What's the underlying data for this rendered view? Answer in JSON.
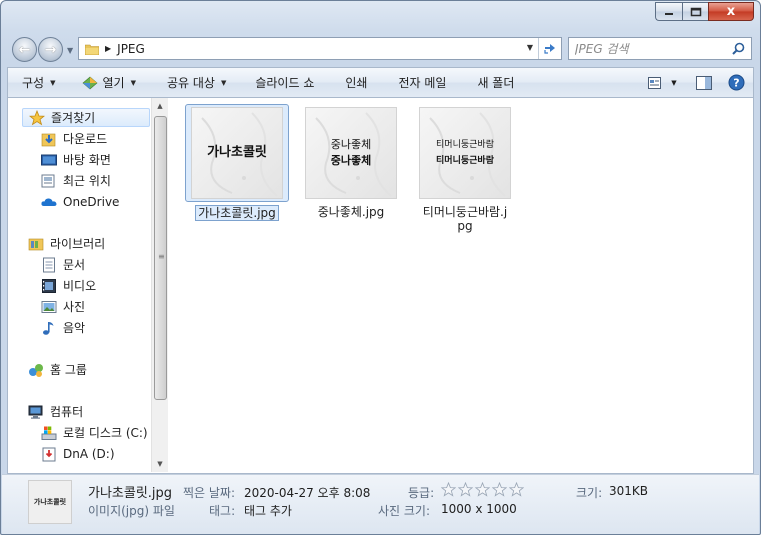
{
  "window": {
    "caption": {
      "close": "x"
    }
  },
  "nav": {
    "breadcrumb": "JPEG",
    "search_placeholder": "JPEG 검색"
  },
  "toolbar": {
    "items": [
      {
        "label": "구성",
        "has_arrow": true
      },
      {
        "label": "열기",
        "has_arrow": true,
        "icon": "open-with-icon"
      },
      {
        "label": "공유 대상",
        "has_arrow": true
      },
      {
        "label": "슬라이드 쇼",
        "has_arrow": false
      },
      {
        "label": "인쇄",
        "has_arrow": false
      },
      {
        "label": "전자 메일",
        "has_arrow": false
      },
      {
        "label": "새 폴더",
        "has_arrow": false
      }
    ]
  },
  "sidebar": {
    "favorites": {
      "label": "즐겨찾기",
      "icon": "star-icon"
    },
    "favorites_items": [
      {
        "label": "다운로드",
        "icon": "downloads-folder-icon"
      },
      {
        "label": "바탕 화면",
        "icon": "desktop-icon"
      },
      {
        "label": "최근 위치",
        "icon": "recent-places-icon"
      },
      {
        "label": "OneDrive",
        "icon": "cloud-icon"
      }
    ],
    "libraries": {
      "label": "라이브러리",
      "icon": "library-icon"
    },
    "libraries_items": [
      {
        "label": "문서",
        "icon": "documents-icon"
      },
      {
        "label": "비디오",
        "icon": "video-icon"
      },
      {
        "label": "사진",
        "icon": "pictures-icon"
      },
      {
        "label": "음악",
        "icon": "music-icon"
      }
    ],
    "homegroup": {
      "label": "홈 그룹",
      "icon": "homegroup-icon"
    },
    "computer": {
      "label": "컴퓨터",
      "icon": "computer-icon"
    },
    "computer_items": [
      {
        "label": "로컬 디스크 (C:)",
        "icon": "local-disk-icon"
      },
      {
        "label": "DnA (D:)",
        "icon": "drive-icon"
      }
    ]
  },
  "files": [
    {
      "name": "가나초콜릿.jpg",
      "thumb_lines": [
        "가나초콜릿"
      ],
      "selected": true
    },
    {
      "name": "중나좋체.jpg",
      "thumb_lines": [
        "중나좋체",
        "중나좋체"
      ],
      "selected": false
    },
    {
      "name": "티머니둥근바람.jpg",
      "thumb_lines": [
        "티머니둥근바람",
        "티머니둥근바람"
      ],
      "selected": false
    }
  ],
  "details": {
    "name": "가나초콜릿.jpg",
    "type": "이미지(jpg) 파일",
    "thumb_text": "가나초콜릿",
    "date_label": "찍은 날짜:",
    "date_value": "2020-04-27 오후 8:08",
    "tags_label": "태그:",
    "tags_value": "태그 추가",
    "rating_label": "등급:",
    "rating_value": 0,
    "rating_max": 5,
    "dimensions_label": "사진 크기:",
    "dimensions_value": "1000 x 1000",
    "size_label": "크기:",
    "size_value": "301KB"
  },
  "colors": {
    "accent": "#3a6fb0",
    "selection": "#dcebfc"
  }
}
